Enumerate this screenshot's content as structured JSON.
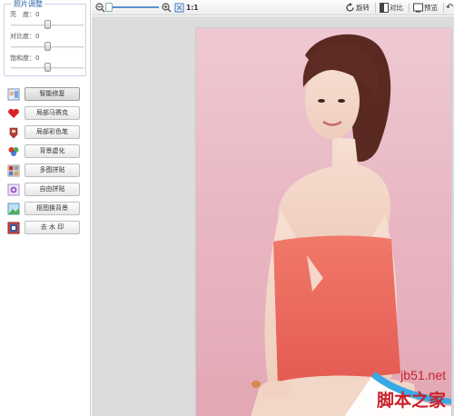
{
  "adjust": {
    "legend": "照片调整",
    "sliders": [
      {
        "label": "亮　度：0",
        "value": 0
      },
      {
        "label": "对比度：0",
        "value": 0
      },
      {
        "label": "饱和度：0",
        "value": 0
      }
    ]
  },
  "tools": [
    {
      "label": "智能修复",
      "icon": "smart-repair-icon",
      "active": true
    },
    {
      "label": "局部马赛克",
      "icon": "mosaic-heart-icon"
    },
    {
      "label": "局部彩色笔",
      "icon": "color-pen-icon"
    },
    {
      "label": "背景虚化",
      "icon": "blur-background-icon"
    },
    {
      "label": "多图拼贴",
      "icon": "multi-collage-icon"
    },
    {
      "label": "自由拼贴",
      "icon": "free-collage-icon"
    },
    {
      "label": "抠图换背景",
      "icon": "cutout-background-icon"
    },
    {
      "label": "去 水 印",
      "icon": "remove-watermark-icon"
    }
  ],
  "toolbar": {
    "zoom_ratio": "1:1",
    "rotate": "旋转",
    "compare": "对比",
    "preview": "预览",
    "undo": "↶"
  },
  "watermark": {
    "site": "jb51.net",
    "name": "脚本之家"
  },
  "colors": {
    "accent": "#2a62a6",
    "watermark": "#c9202a",
    "canvas": "#dcdcdc"
  }
}
